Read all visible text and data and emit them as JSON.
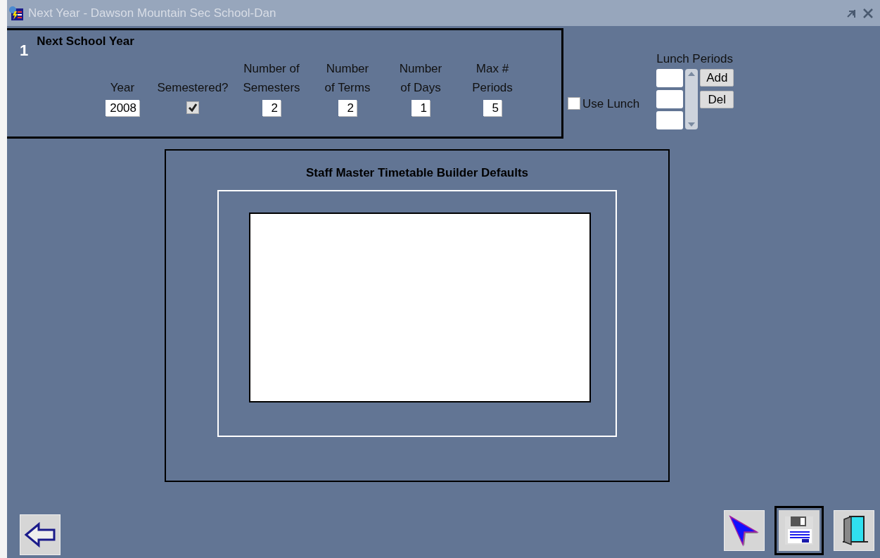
{
  "window": {
    "title": "Next Year - Dawson Mountain Sec School-Dan"
  },
  "section": {
    "number": "1",
    "title": "Next School Year",
    "fields": [
      {
        "kind": "text",
        "label": "Year",
        "value": "2008"
      },
      {
        "kind": "checkbox",
        "label": "Semestered?",
        "checked": true
      },
      {
        "kind": "text",
        "label": "Number of\nSemesters",
        "value": "2"
      },
      {
        "kind": "text",
        "label": "Number\nof Terms",
        "value": "2"
      },
      {
        "kind": "text",
        "label": "Number\nof Days",
        "value": "1"
      },
      {
        "kind": "text",
        "label": "Max #\nPeriods",
        "value": "5"
      }
    ]
  },
  "use_lunch": {
    "label": "Use Lunch",
    "checked": false
  },
  "lunch_periods": {
    "label": "Lunch Periods",
    "buttons": [
      "Add",
      "Del"
    ]
  },
  "defaults_panel": {
    "title": "Staff Master Timetable Builder Defaults"
  },
  "toolbar": [
    {
      "kind": "pointer",
      "selected": false
    },
    {
      "kind": "save",
      "selected": true
    },
    {
      "kind": "exit",
      "selected": false
    }
  ]
}
